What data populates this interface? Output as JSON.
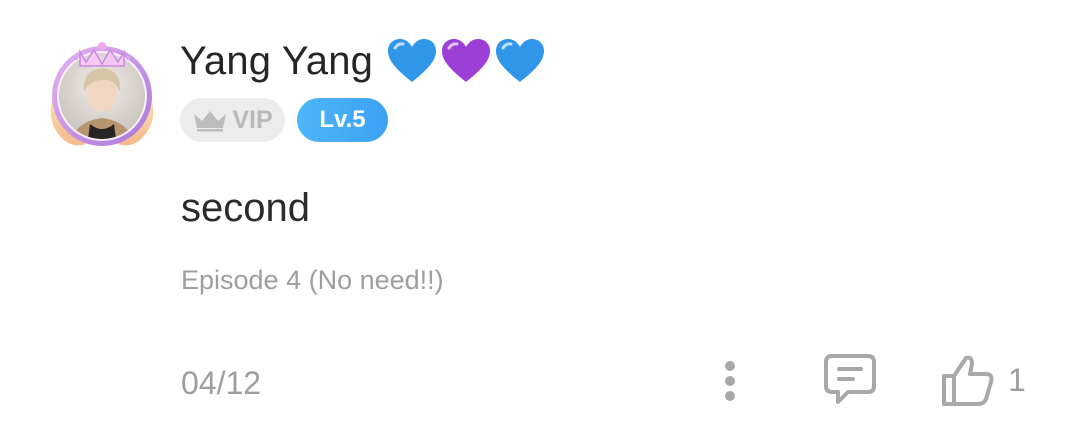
{
  "user": {
    "name": "Yang Yang",
    "hearts": [
      "blue-heart-icon",
      "purple-heart-icon",
      "blue-heart-icon"
    ],
    "badges": {
      "vip_label": "VIP",
      "level_label": "Lv.5"
    }
  },
  "comment": {
    "text": "second",
    "episode": "Episode 4 (No need!!)",
    "date": "04/12"
  },
  "actions": {
    "like_count": "1"
  },
  "colors": {
    "username": "#262626",
    "secondary_text": "#9e9e9e",
    "level_badge": "#3fa8f5",
    "vip_badge_bg": "#ececec",
    "icon_gray": "#a8a8a8",
    "blue_heart": "#2f96ea",
    "purple_heart": "#9b3fd6"
  }
}
